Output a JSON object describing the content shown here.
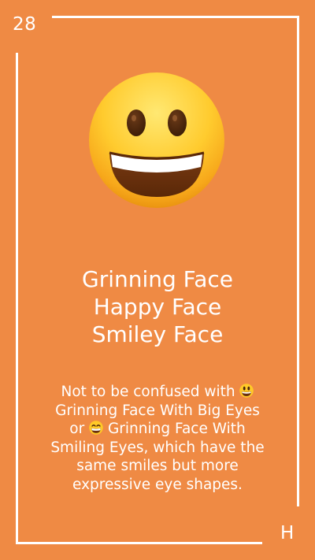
{
  "card": {
    "number": "28",
    "letter": "H",
    "background_color": "#EF8A44",
    "frame_color": "#FFFFFF"
  },
  "emoji": {
    "icon": "grinning-face-icon"
  },
  "names": [
    "Grinning Face",
    "Happy Face",
    "Smiley Face"
  ],
  "description": {
    "part1": "Not to be confused with ",
    "emoji1_icon": "grinning-face-with-big-eyes-icon",
    "part2": " Grinning Face With Big Eyes or ",
    "emoji2_icon": "grinning-face-with-smiling-eyes-icon",
    "part3": " Grinning Face With Smiling Eyes, which have the same smiles but more expressive eye shapes."
  }
}
